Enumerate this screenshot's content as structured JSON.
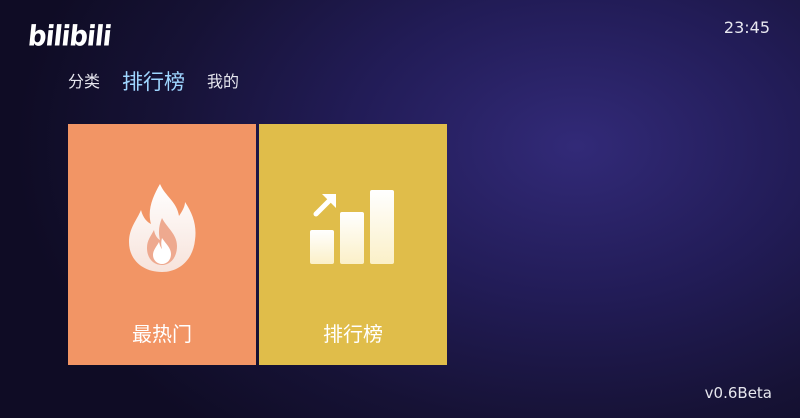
{
  "header": {
    "logo_text": "bilibili",
    "clock": "23:45"
  },
  "tabs": [
    {
      "label": "分类",
      "active": false
    },
    {
      "label": "排行榜",
      "active": true
    },
    {
      "label": "我的",
      "active": false
    }
  ],
  "tiles": [
    {
      "label": "最热门",
      "icon": "flame-icon",
      "color": "#f29565"
    },
    {
      "label": "排行榜",
      "icon": "ranking-chart-icon",
      "color": "#e0bd4a"
    }
  ],
  "footer": {
    "version": "v0.6Beta"
  },
  "colors": {
    "background": "#221c57",
    "active_tab": "#9fd6ff"
  }
}
